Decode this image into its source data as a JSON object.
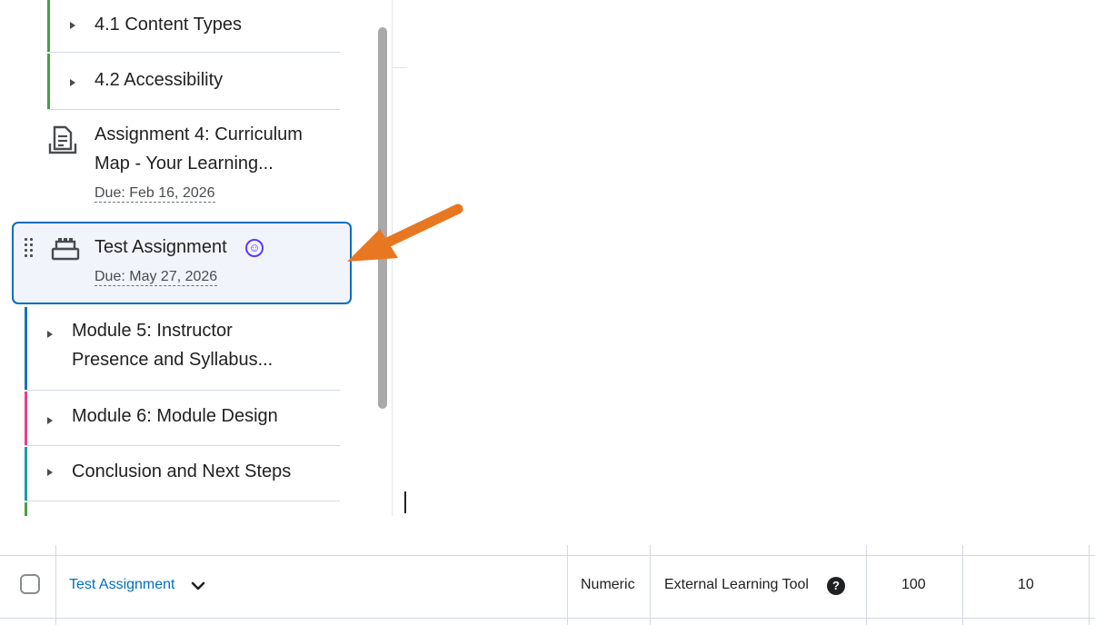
{
  "tree": {
    "items": [
      {
        "label": "4.1 Content Types"
      },
      {
        "label": "4.2 Accessibility"
      },
      {
        "label_line1": "Assignment 4: Curriculum",
        "label_line2": "Map - Your Learning...",
        "due": "Due: Feb 16, 2026",
        "icon": "assignment-document-icon"
      },
      {
        "label": "Test Assignment",
        "due": "Due: May 27, 2026",
        "icon": "external-tool-icon",
        "badge_icon": "accessibility-icon",
        "selected": true
      },
      {
        "label_line1": "Module 5: Instructor",
        "label_line2": "Presence and Syllabus..."
      },
      {
        "label": "Module 6: Module Design"
      },
      {
        "label": "Conclusion and Next Steps"
      }
    ],
    "colors": {
      "module4": "#43a047",
      "module5": "#1a73b8",
      "module6": "#e83f8a",
      "conclusion": "#1a9aa8",
      "selected_border": "#006fbf",
      "arrow": "#e87722"
    }
  },
  "table": {
    "row": {
      "name": "Test Assignment",
      "type": "Numeric",
      "tool": "External Learning Tool",
      "max_points": "100",
      "weight": "10"
    },
    "help_icon": "question-circle-icon",
    "chevron_icon": "chevron-down-icon"
  }
}
